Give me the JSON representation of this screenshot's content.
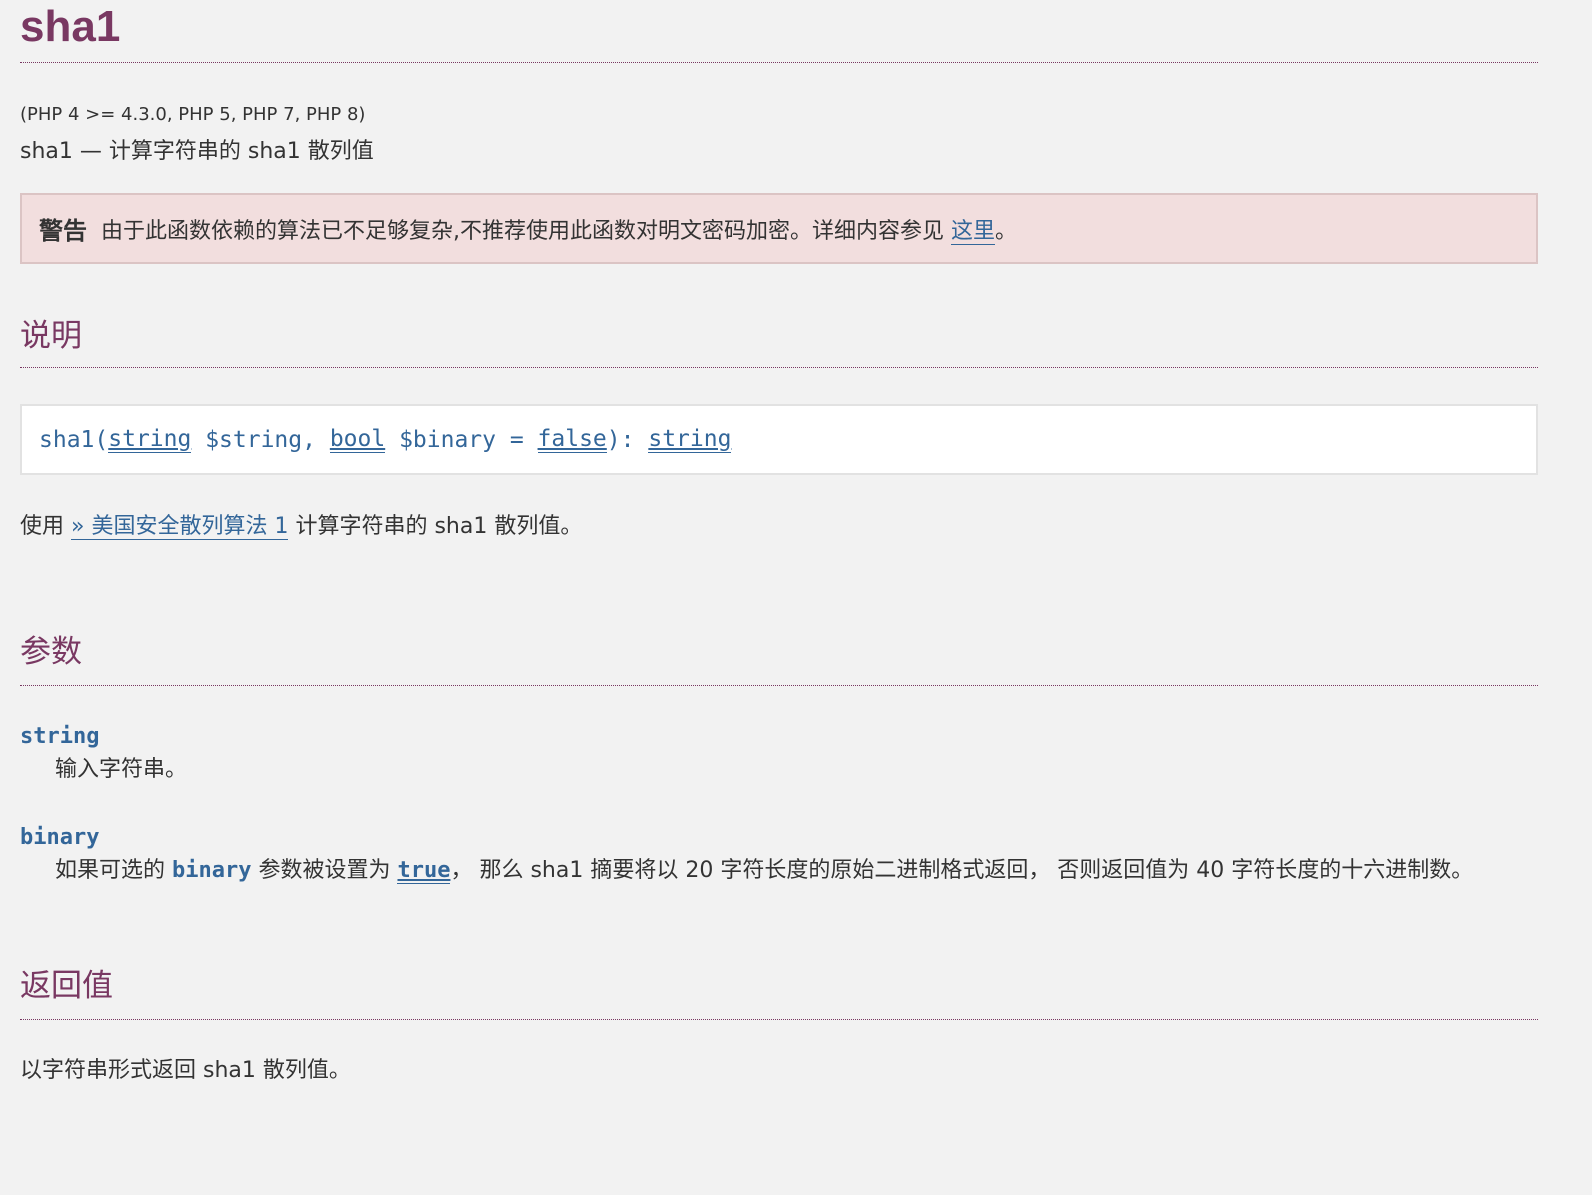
{
  "page": {
    "title": "sha1",
    "versions": "(PHP 4 >= 4.3.0, PHP 5, PHP 7, PHP 8)",
    "refpurpose": "sha1 — 计算字符串的 sha1 散列值"
  },
  "warning": {
    "label": "警告",
    "text": "由于此函数依赖的算法已不足够复杂,不推荐使用此函数对明文密码加密。详细内容参见 ",
    "link_text": "这里",
    "suffix": "。"
  },
  "description": {
    "heading": "说明",
    "synopsis": {
      "func": "sha1(",
      "type1": "string",
      "param1": " $string",
      "sep": ", ",
      "type2": "bool",
      "param2": " $binary = ",
      "default": "false",
      "close": "): ",
      "return_type": "string"
    },
    "para_prefix": "使用 ",
    "para_link": "» 美国安全散列算法 1",
    "para_suffix": " 计算字符串的 sha1 散列值。"
  },
  "parameters": {
    "heading": "参数",
    "items": [
      {
        "name": "string",
        "desc": "输入字符串。"
      },
      {
        "name": "binary",
        "desc_prefix": "如果可选的 ",
        "desc_code": "binary",
        "desc_mid": " 参数被设置为 ",
        "desc_link": "true",
        "desc_suffix": "， 那么 sha1 摘要将以 20 字符长度的原始二进制格式返回， 否则返回值为 40 字符长度的十六进制数。"
      }
    ]
  },
  "return_values": {
    "heading": "返回值",
    "text": "以字符串形式返回 sha1 散列值。"
  },
  "colors": {
    "heading": "#793862",
    "link": "#336699",
    "warning_bg": "#f2dede",
    "background": "#f2f2f2"
  }
}
